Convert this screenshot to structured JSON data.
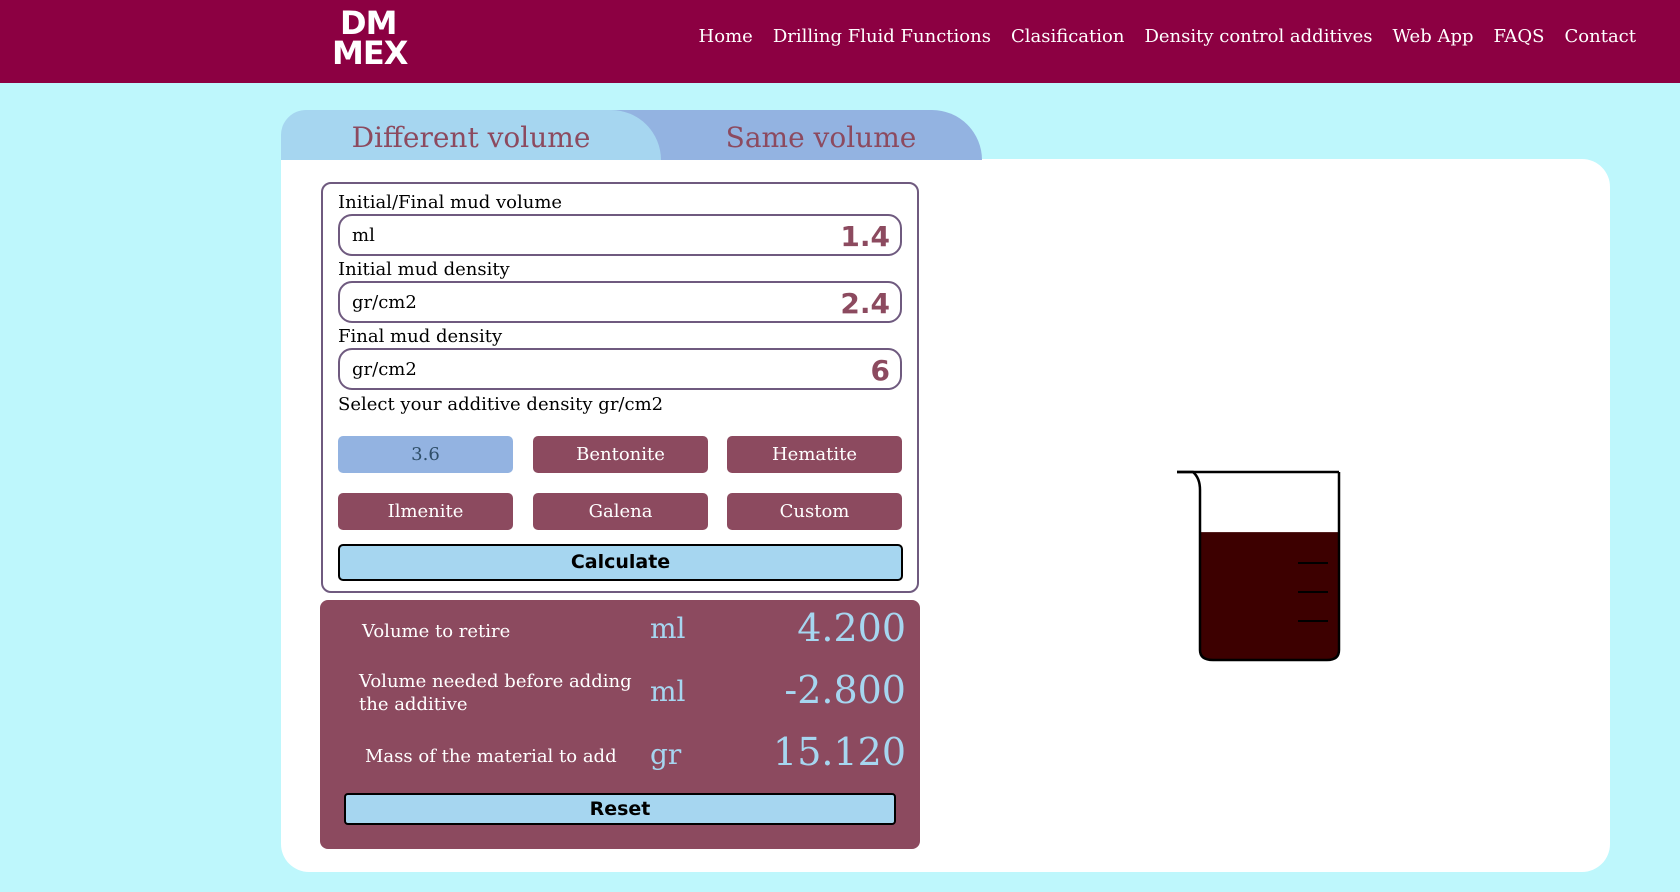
{
  "header": {
    "logo_line1": "DM",
    "logo_line2": "MEX",
    "nav": [
      "Home",
      "Drilling Fluid Functions",
      "Clasification",
      "Density control additives",
      "Web App",
      "FAQS",
      "Contact"
    ]
  },
  "tabs": {
    "different": "Different volume",
    "same": "Same volume"
  },
  "form": {
    "mud_volume_label": "Initial/Final mud volume",
    "mud_volume_unit": "ml",
    "mud_volume_value": "1.4",
    "initial_density_label": "Initial mud density",
    "initial_density_unit": "gr/cm2",
    "initial_density_value": "2.4",
    "final_density_label": "Final mud density",
    "final_density_unit": "gr/cm2",
    "final_density_value": "6",
    "additive_label": "Select your additive density gr/cm2",
    "additives": [
      "3.6",
      "Bentonite",
      "Hematite",
      "Ilmenite",
      "Galena",
      "Custom"
    ],
    "calculate_label": "Calculate"
  },
  "results": {
    "retire_label": "Volume to retire",
    "retire_unit": "ml",
    "retire_value": "4.200",
    "needed_label": "Volume needed before adding the additive",
    "needed_unit": "ml",
    "needed_value": "-2.800",
    "mass_label": "Mass of the material to add",
    "mass_unit": "gr",
    "mass_value": "15.120",
    "reset_label": "Reset"
  },
  "colors": {
    "header_bg": "#8c0042",
    "page_bg": "#bef7fc",
    "accent": "#8c4a5f",
    "light_blue": "#a6d6f0",
    "tab_blue": "#93b3e1",
    "liquid": "#3d0000"
  },
  "beaker": {
    "fill_level": 0.68
  }
}
